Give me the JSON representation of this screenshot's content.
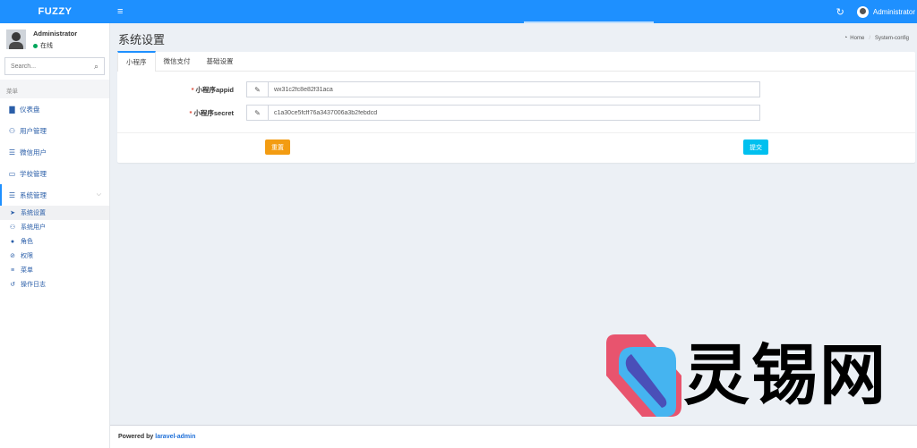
{
  "header": {
    "logo": "FUZZY",
    "hamburger": "≡",
    "user_name": "Administrator"
  },
  "sidebar": {
    "user": {
      "name": "Administrator",
      "status": "在线"
    },
    "search_placeholder": "Search...",
    "menu_header": "菜单",
    "items": [
      {
        "label": "仪表盘",
        "icon": "bar-chart-icon"
      },
      {
        "label": "用户管理",
        "icon": "users-icon"
      },
      {
        "label": "微信用户",
        "icon": "list-icon"
      },
      {
        "label": "学校管理",
        "icon": "id-card-icon"
      },
      {
        "label": "系统管理",
        "icon": "tasks-icon"
      }
    ],
    "subitems": [
      {
        "label": "系统设置",
        "icon": "paper-plane-icon"
      },
      {
        "label": "系统用户",
        "icon": "users-icon"
      },
      {
        "label": "角色",
        "icon": "user-icon"
      },
      {
        "label": "权限",
        "icon": "ban-icon"
      },
      {
        "label": "菜单",
        "icon": "bars-icon"
      },
      {
        "label": "操作日志",
        "icon": "history-icon"
      }
    ]
  },
  "content": {
    "title": "系统设置",
    "breadcrumb": {
      "home": "Home",
      "current": "System-config"
    },
    "tabs": [
      "小程序",
      "微信支付",
      "基础设置"
    ],
    "fields": [
      {
        "label": "小程序appid",
        "value": "wx31c2fc8e82f31aca"
      },
      {
        "label": "小程序secret",
        "value": "c1a30ce5fcff76a3437006a3b2febdcd"
      }
    ],
    "reset_label": "重置",
    "submit_label": "提交"
  },
  "watermark": {
    "text": "灵锡网"
  },
  "footer": {
    "prefix": "Powered by",
    "link": "laravel-admin"
  },
  "colors": {
    "header_bg": "#1e90ff",
    "link": "#2a5ea8",
    "reset": "#f39c12",
    "submit": "#00c0ef",
    "status_online": "#00a65a"
  }
}
